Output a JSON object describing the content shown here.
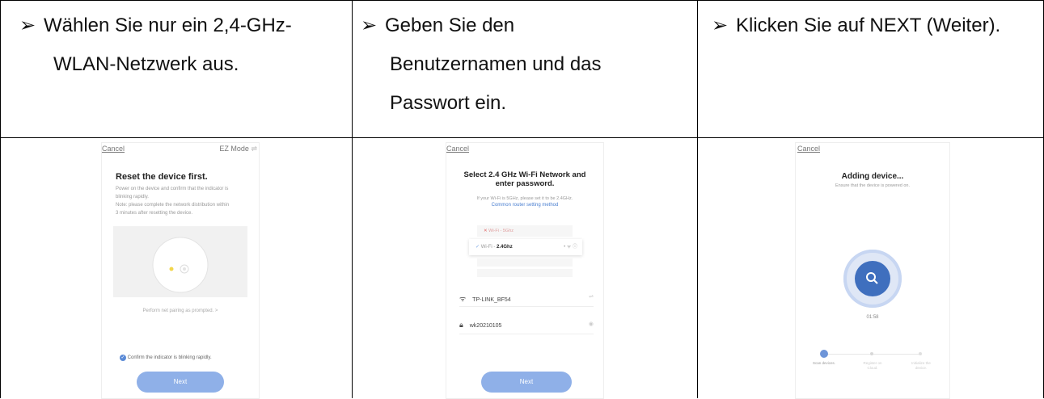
{
  "instructions": [
    {
      "arrow": "➢",
      "lines": [
        "Wählen Sie nur ein 2,4-GHz-",
        "WLAN-Netzwerk aus."
      ]
    },
    {
      "arrow": "➢",
      "lines": [
        "Geben Sie den",
        "Benutzernamen und das",
        "Passwort ein."
      ]
    },
    {
      "arrow": "➢",
      "lines": [
        "Klicken Sie auf NEXT (Weiter)."
      ]
    }
  ],
  "screen1": {
    "cancel": "Cancel",
    "mode": "EZ Mode",
    "title": "Reset the device first.",
    "desc1": "Power on the device and confirm that the indicator is",
    "desc2": "blinking rapidly.",
    "desc3": "Note: please complete the network distribution within",
    "desc4": "3 minutes after resetting the device.",
    "prompt": "Perform net pairing as prompted. >",
    "confirm": "Confirm the indicator is blinking rapidly.",
    "next": "Next"
  },
  "screen2": {
    "cancel": "Cancel",
    "title1": "Select 2.4 GHz Wi-Fi Network and",
    "title2": "enter password.",
    "hint": "If your Wi-Fi is 5GHz, please set it to be 2.4GHz.",
    "link": "Common router setting method",
    "wifi_5": "Wi-Fi - 5Ghz",
    "wifi_24_prefix": "Wi-Fi - ",
    "wifi_24": "2.4Ghz",
    "ssid": "TP-LINK_BF54",
    "password": "wk20210105",
    "next": "Next"
  },
  "screen3": {
    "cancel": "Cancel",
    "title": "Adding device...",
    "subtitle": "Ensure that the device is powered on.",
    "timer": "01:58",
    "step1": "Scan devices.",
    "step2": "Register on Cloud.",
    "step3": "Initialize the device."
  },
  "colors": {
    "accent": "#8fb0e8",
    "link": "#4a7fd0",
    "ring": "#3f6fbe"
  }
}
